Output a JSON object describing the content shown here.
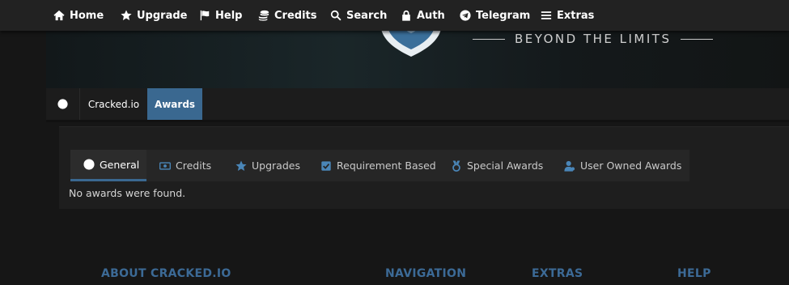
{
  "nav": {
    "items": [
      {
        "label": "Home",
        "icon": "home-icon"
      },
      {
        "label": "Upgrade",
        "icon": "star-icon"
      },
      {
        "label": "Help",
        "icon": "flag-icon"
      },
      {
        "label": "Credits",
        "icon": "coins-icon"
      },
      {
        "label": "Search",
        "icon": "search-icon"
      },
      {
        "label": "Auth",
        "icon": "lock-icon"
      },
      {
        "label": "Telegram",
        "icon": "telegram-icon"
      },
      {
        "label": "Extras",
        "icon": "menu-icon"
      }
    ]
  },
  "banner": {
    "tagline": "BEYOND THE LIMITS"
  },
  "breadcrumb": {
    "site": "Cracked.io",
    "current": "Awards"
  },
  "tabs": [
    {
      "label": "General",
      "icon": "globe-icon",
      "active": true
    },
    {
      "label": "Credits",
      "icon": "money-icon",
      "active": false
    },
    {
      "label": "Upgrades",
      "icon": "star-icon",
      "active": false
    },
    {
      "label": "Requirement Based",
      "icon": "checkbox-icon",
      "active": false
    },
    {
      "label": "Special Awards",
      "icon": "medal-icon",
      "active": false
    },
    {
      "label": "User Owned Awards",
      "icon": "user-icon",
      "active": false
    }
  ],
  "content": {
    "empty_message": "No awards were found."
  },
  "footer": {
    "about": "ABOUT CRACKED.IO",
    "navigation": "NAVIGATION",
    "extras": "EXTRAS",
    "help": "HELP"
  },
  "colors": {
    "accent": "#3a6890",
    "footer_heading": "#3c6a96",
    "background": "#161616",
    "nav_bg": "#222222"
  }
}
